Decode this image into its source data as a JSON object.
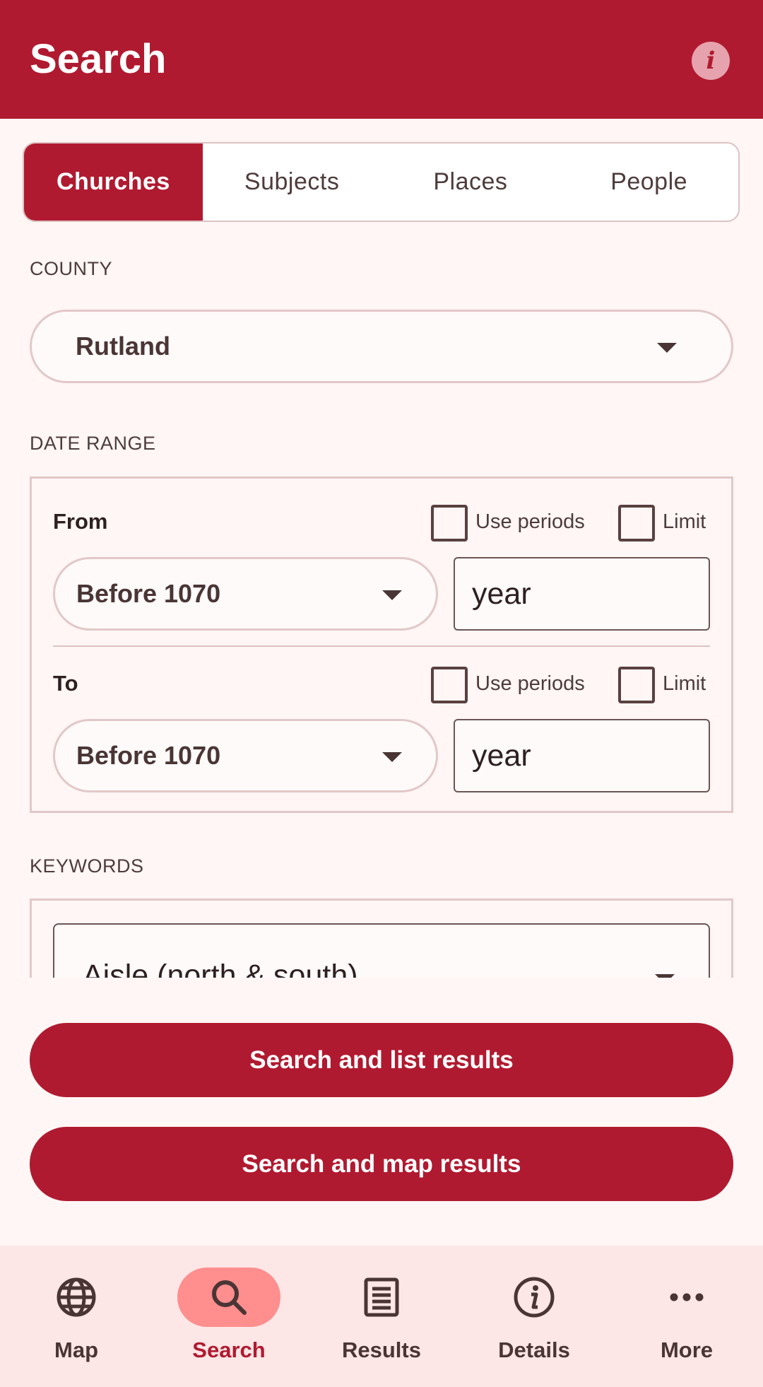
{
  "header": {
    "title": "Search",
    "info_icon": "info-icon"
  },
  "tabs": [
    {
      "label": "Churches",
      "active": true
    },
    {
      "label": "Subjects",
      "active": false
    },
    {
      "label": "Places",
      "active": false
    },
    {
      "label": "People",
      "active": false
    }
  ],
  "county": {
    "label": "COUNTY",
    "value": "Rutland"
  },
  "date_range": {
    "label": "DATE RANGE",
    "from": {
      "label": "From",
      "use_periods": "Use periods",
      "limit": "Limit",
      "period": "Before 1070",
      "year_placeholder": "year"
    },
    "to": {
      "label": "To",
      "use_periods": "Use periods",
      "limit": "Limit",
      "period": "Before 1070",
      "year_placeholder": "year"
    }
  },
  "keywords": {
    "label": "KEYWORDS",
    "value": "Aisle (north & south)"
  },
  "actions": {
    "list": "Search and list results",
    "map": "Search and map results"
  },
  "nav": [
    {
      "label": "Map",
      "icon": "globe-icon",
      "active": false
    },
    {
      "label": "Search",
      "icon": "search-icon",
      "active": true
    },
    {
      "label": "Results",
      "icon": "list-icon",
      "active": false
    },
    {
      "label": "Details",
      "icon": "info-icon",
      "active": false
    },
    {
      "label": "More",
      "icon": "more-icon",
      "active": false
    }
  ],
  "colors": {
    "primary": "#b01a30",
    "background": "#fff6f5",
    "nav_background": "#fde6e6",
    "nav_active_pill": "#ff8e8e"
  }
}
